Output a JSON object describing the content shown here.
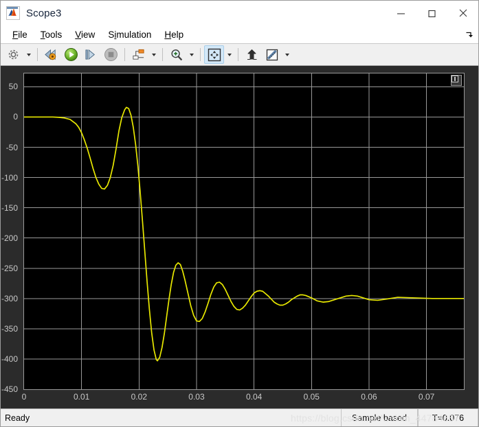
{
  "window": {
    "title": "Scope3",
    "icon": "matlab-membrane-icon",
    "minimize_label": "—",
    "maximize_label": "□",
    "close_label": "✕"
  },
  "menubar": {
    "items": [
      {
        "name": "file",
        "pre": "",
        "key": "F",
        "post": "ile"
      },
      {
        "name": "tools",
        "pre": "",
        "key": "T",
        "post": "ools"
      },
      {
        "name": "view",
        "pre": "",
        "key": "V",
        "post": "iew"
      },
      {
        "name": "simulation",
        "pre": "S",
        "key": "i",
        "post": "mulation"
      },
      {
        "name": "help",
        "pre": "",
        "key": "H",
        "post": "elp"
      }
    ],
    "undock_icon": "undock-arrow-icon"
  },
  "toolbar": {
    "items": [
      {
        "name": "configuration-properties-button",
        "icon": "gear-icon",
        "dropdown": true,
        "selected": false
      },
      {
        "name": "step-back-button",
        "icon": "step-back-icon",
        "dropdown": false,
        "selected": false
      },
      {
        "name": "run-button",
        "icon": "play-icon",
        "dropdown": false,
        "selected": false
      },
      {
        "name": "step-forward-button",
        "icon": "step-forward-icon",
        "dropdown": false,
        "selected": false
      },
      {
        "name": "stop-button",
        "icon": "stop-icon",
        "dropdown": false,
        "selected": false
      },
      {
        "name": "signal-selector-button",
        "icon": "signal-blocks-icon",
        "dropdown": true,
        "selected": false
      },
      {
        "name": "zoom-in-button",
        "icon": "zoom-in-icon",
        "dropdown": true,
        "selected": false
      },
      {
        "name": "pan-button",
        "icon": "pan-arrows-icon",
        "dropdown": true,
        "selected": true
      },
      {
        "name": "autoscale-button",
        "icon": "autoscale-icon",
        "dropdown": false,
        "selected": false
      },
      {
        "name": "measurements-button",
        "icon": "ruler-icon",
        "dropdown": true,
        "selected": false
      }
    ]
  },
  "plot": {
    "maximize_axes_icon": "maximize-axes-icon",
    "background": "#000000",
    "grid_color": "#9a9a9a",
    "trace_color": "#e8e800",
    "panel_background": "#2b2b2b",
    "tick_text_color": "#c8c8c8"
  },
  "statusbar": {
    "status": "Ready",
    "frame_mode": "Sample based",
    "time": "T=0.076",
    "watermark": "https://blog.csdn.net/weixin_44784657"
  },
  "chart_data": {
    "type": "line",
    "title": "",
    "xlabel": "",
    "ylabel": "",
    "xlim": [
      0,
      0.0765
    ],
    "ylim": [
      -450,
      72
    ],
    "grid": true,
    "legend": null,
    "xticks": [
      0,
      0.01,
      0.02,
      0.03,
      0.04,
      0.05,
      0.06,
      0.07
    ],
    "xtick_labels": [
      "0",
      "0.01",
      "0.02",
      "0.03",
      "0.04",
      "0.05",
      "0.06",
      "0.07"
    ],
    "yticks": [
      50,
      0,
      -50,
      -100,
      -150,
      -200,
      -250,
      -300,
      -350,
      -400,
      -450
    ],
    "ytick_labels": [
      "50",
      "0",
      "-50",
      "-100",
      "-150",
      "-200",
      "-250",
      "-300",
      "-350",
      "-400",
      "-450"
    ],
    "series": [
      {
        "name": "signal",
        "color": "#e8e800",
        "description": "Damped oscillatory step response settling to -300",
        "x": [
          0,
          0.001,
          0.002,
          0.003,
          0.004,
          0.005,
          0.006,
          0.007,
          0.008,
          0.009,
          0.0095,
          0.01,
          0.0105,
          0.011,
          0.0115,
          0.012,
          0.0125,
          0.013,
          0.0135,
          0.014,
          0.0145,
          0.015,
          0.0155,
          0.016,
          0.0165,
          0.017,
          0.0175,
          0.0178,
          0.0182,
          0.0186,
          0.019,
          0.0194,
          0.0198,
          0.0202,
          0.0206,
          0.021,
          0.0214,
          0.0218,
          0.0222,
          0.0226,
          0.023,
          0.0232,
          0.0236,
          0.024,
          0.0244,
          0.0248,
          0.0252,
          0.0256,
          0.026,
          0.0264,
          0.0268,
          0.0272,
          0.0276,
          0.028,
          0.0285,
          0.029,
          0.0295,
          0.03,
          0.0305,
          0.031,
          0.0315,
          0.032,
          0.0325,
          0.033,
          0.0335,
          0.034,
          0.0345,
          0.035,
          0.0355,
          0.036,
          0.0365,
          0.037,
          0.0375,
          0.038,
          0.0385,
          0.039,
          0.0395,
          0.04,
          0.0405,
          0.041,
          0.0415,
          0.042,
          0.0425,
          0.043,
          0.0435,
          0.044,
          0.0445,
          0.045,
          0.0455,
          0.046,
          0.0465,
          0.047,
          0.0475,
          0.048,
          0.0485,
          0.049,
          0.05,
          0.051,
          0.052,
          0.053,
          0.054,
          0.055,
          0.056,
          0.057,
          0.058,
          0.059,
          0.06,
          0.0615,
          0.063,
          0.065,
          0.068,
          0.071,
          0.074,
          0.0765
        ],
        "y": [
          0,
          0,
          0,
          0,
          0,
          0,
          -0.5,
          -1.5,
          -4,
          -11,
          -17,
          -26,
          -38,
          -52,
          -68,
          -85,
          -100,
          -111,
          -118,
          -119,
          -113,
          -100,
          -80,
          -53,
          -23,
          -1,
          12,
          16,
          14,
          3,
          -17,
          -45,
          -81,
          -124,
          -172,
          -222,
          -272,
          -318,
          -357,
          -385,
          -401,
          -403,
          -397,
          -381,
          -358,
          -330,
          -302,
          -277,
          -257,
          -245,
          -241,
          -244,
          -255,
          -270,
          -291,
          -312,
          -328,
          -337,
          -338,
          -333,
          -322,
          -308,
          -293,
          -281,
          -274,
          -273,
          -277,
          -285,
          -295,
          -305,
          -313,
          -318,
          -319,
          -316,
          -311,
          -304,
          -297,
          -291,
          -288,
          -287,
          -288,
          -292,
          -296,
          -301,
          -306,
          -309,
          -311,
          -311,
          -309,
          -306,
          -302,
          -299,
          -296,
          -294,
          -294,
          -295,
          -299,
          -304,
          -306,
          -305,
          -302,
          -299,
          -296,
          -295,
          -296,
          -299,
          -302,
          -303,
          -301,
          -298,
          -299,
          -300,
          -300,
          -300
        ]
      }
    ]
  }
}
